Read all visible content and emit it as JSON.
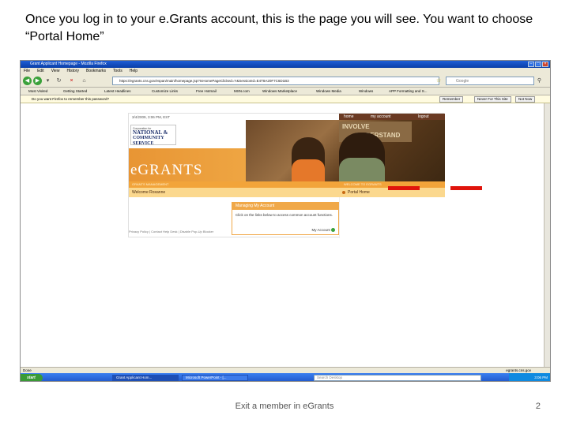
{
  "slide": {
    "caption": "Once you log in to your e.Grants account, this is the page you will see.  You want to choose “Portal Home”",
    "footer": "Exit a member in eGrants",
    "page_number": "2"
  },
  "browser": {
    "title": "Grant Applicant Homepage - Mozilla Firefox",
    "menu": [
      "File",
      "Edit",
      "View",
      "History",
      "Bookmarks",
      "Tools",
      "Help"
    ],
    "url": "https://egrants.cns.gov/espan/main/homepage.jsp?IsHomePageClicked=Y&SessionId=E4T8A20F7C6D1B3",
    "search_placeholder": "Google",
    "bookmarks": [
      "Most Visited",
      "Getting Started",
      "Latest Headlines",
      "Customize Links",
      "Free Hotmail",
      "MSN.com",
      "Windows Marketplace",
      "Windows Media",
      "Windows",
      "APP Formatting and S..."
    ],
    "password_prompt": "Do you want Firefox to remember this password?",
    "password_buttons": [
      "Remember",
      "Never For This Site",
      "Not Now"
    ],
    "status_left": "Done",
    "status_right": "egrants.cns.gov"
  },
  "egrants_page": {
    "date": "3/4/2009, 3:06 PM, EST",
    "top_nav": [
      "home",
      "my account",
      "logout"
    ],
    "logo_line1": "Corporation for",
    "logo_line2": "NATIONAL &",
    "logo_line3": "COMMUNITY SERVICE",
    "banner_title": "eGRANTS",
    "strip_left": "GRANTS MANAGEMENT",
    "strip_right": "WELCOME TO EGRANTS",
    "board_text_1": "INVOLVE",
    "board_text_2": "UNDERSTAND",
    "welcome": "Welcome Roxanne",
    "portal_home": "Portal Home",
    "box_title": "Managing My Account",
    "box_body": "Click on the links below to access common account functions.",
    "box_link": "My Account",
    "footer_links": "Privacy Policy  |  Contact Help Desk  |  Disable Pop-Up Blocker"
  },
  "taskbar": {
    "start": "start",
    "items": [
      "Grant Applicant Hom...",
      "Microsoft PowerPoint - [...",
      ""
    ],
    "desktop_search": "Search Desktop",
    "clock": "3:06 PM"
  },
  "colors": {
    "egrants_orange": "#f2a43a",
    "egrants_brown": "#6a3a23",
    "arrow_red": "#e0140c"
  }
}
